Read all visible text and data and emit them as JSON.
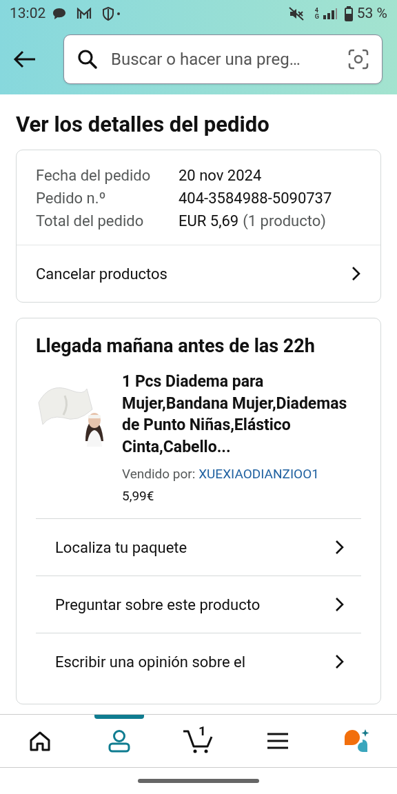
{
  "status_bar": {
    "time": "13:02",
    "network": "4G",
    "battery": "53 %"
  },
  "header": {
    "search": {
      "placeholder": "Buscar o hacer una preg…"
    }
  },
  "title": "Ver los detalles del pedido",
  "order_summary": {
    "rows": [
      {
        "label": "Fecha del pedido",
        "value": "20 nov 2024"
      },
      {
        "label": "Pedido n.º",
        "value": "404-3584988-5090737"
      },
      {
        "label": "Total del pedido",
        "value": "EUR 5,69",
        "note": "(1 producto)"
      }
    ],
    "action": "Cancelar productos"
  },
  "shipment": {
    "heading": "Llegada mañana antes de las 22h",
    "product": {
      "title": "1 Pcs Diadema para Mujer,Bandana Mujer,Diademas de Punto Niñas,Elástico Cinta,Cabello...",
      "seller_label": "Vendido por:",
      "seller": "XUEXIAODIANZIOO1",
      "price": "5,99€"
    },
    "actions": [
      "Localiza tu paquete",
      "Preguntar sobre este producto",
      "Escribir una opinión sobre el"
    ]
  },
  "bottom_nav": [
    {
      "kind": "home",
      "selected": false
    },
    {
      "kind": "account",
      "selected": true
    },
    {
      "kind": "cart",
      "selected": false,
      "badge": "1"
    },
    {
      "kind": "menu",
      "selected": false
    },
    {
      "kind": "assistant",
      "selected": false
    }
  ]
}
